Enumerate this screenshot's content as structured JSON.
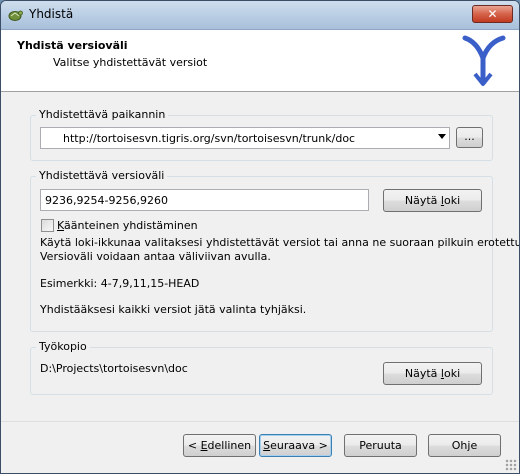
{
  "window": {
    "title": "Yhdistä",
    "close_symbol": "✕"
  },
  "header": {
    "title": "Yhdistä versioväli",
    "subtitle": "Valitse yhdistettävät versiot"
  },
  "repository": {
    "label": "Yhdistettävä paikannin",
    "url": "http://tortoisesvn.tigris.org/svn/tortoisesvn/trunk/doc",
    "browse_label": "..."
  },
  "revisions": {
    "label": "Yhdistettävä versioväli",
    "value": "9236,9254-9256,9260",
    "show_log_label": "Näytä loki",
    "reverse_label": "Käänteinen yhdistäminen",
    "reverse_checked": false,
    "help_line1": "Käytä loki-ikkunaa valitaksesi yhdistettävät versiot tai anna ne suoraan pilkuin erotettuina.",
    "help_line2": "Versioväli voidaan antaa väliviivan avulla.",
    "example": "Esimerkki: 4-7,9,11,15-HEAD",
    "empty_hint": "Yhdistääksesi kaikki versiot jätä valinta tyhjäksi."
  },
  "working_copy": {
    "label": "Työkopio",
    "path": "D:\\Projects\\tortoisesvn\\doc",
    "show_log_label": "Näytä loki"
  },
  "footer": {
    "back_label": "< Edellinen",
    "next_label": "Seuraava >",
    "cancel_label": "Peruuta",
    "help_label": "Ohje"
  },
  "colors": {
    "title_bar": "#bcd0e6",
    "close_button": "#c13b20",
    "logo": "#3b5fc8"
  }
}
